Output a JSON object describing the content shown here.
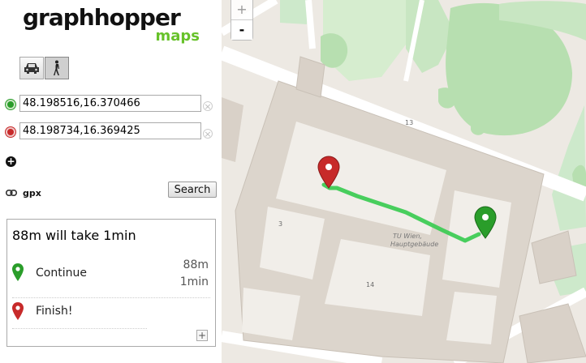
{
  "app": {
    "logo_main": "graphhopper",
    "logo_sub": "maps"
  },
  "vehicles": [
    {
      "name": "car",
      "icon": "car-icon",
      "selected": false
    },
    {
      "name": "foot",
      "icon": "walk-icon",
      "selected": true
    }
  ],
  "route_points": {
    "start": {
      "value": "48.198516,16.370466",
      "icon": "start-point-icon",
      "color": "#2a9d2a"
    },
    "end": {
      "value": "48.198734,16.369425",
      "icon": "end-point-icon",
      "color": "#c72a2a"
    }
  },
  "gpx_label": "gpx",
  "search_label": "Search",
  "results": {
    "summary": "88m will take 1min",
    "instructions": [
      {
        "icon": "green-marker-icon",
        "text": "Continue",
        "distance": "88m",
        "time": "1min"
      },
      {
        "icon": "red-marker-icon",
        "text": "Finish!"
      }
    ],
    "more_label": "+"
  },
  "map": {
    "zoom_in": "+",
    "zoom_out": "-",
    "route_color": "#3ecb55",
    "labels": {
      "house_13": "13",
      "house_3": "3",
      "house_14": "14",
      "building_line1": "TU Wien,",
      "building_line2": "Hauptgebäude"
    }
  }
}
